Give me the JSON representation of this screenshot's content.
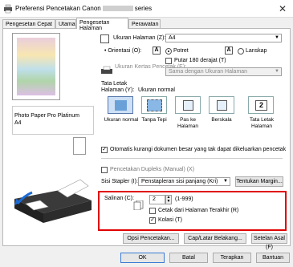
{
  "window": {
    "title_prefix": "Preferensi Pencetakan Canon",
    "title_suffix": "series",
    "close_glyph": "✕"
  },
  "tabs": [
    {
      "label": "Pengesetan Cepat"
    },
    {
      "label": "Utama"
    },
    {
      "label": "Pengesetan Halaman"
    },
    {
      "label": "Perawatan"
    }
  ],
  "preview": {
    "media_line1": "Photo Paper Pro Platinum",
    "media_line2": "A4"
  },
  "page_size": {
    "label": "Ukuran Halaman (Z):",
    "value": "A4"
  },
  "orientation": {
    "label": "Orientasi (O):",
    "portrait": "Potret",
    "landscape": "Lanskap",
    "rotate180": "Putar 180 derajat (T)",
    "portrait_icon": "A",
    "landscape_icon": "A"
  },
  "printer_paper_size": {
    "label": "Ukuran Kertas Pencetak (E):",
    "value": "Sama dengan Ukuran Halaman"
  },
  "page_layout": {
    "label_line1": "Tata Letak",
    "label_line2": "Halaman (Y):",
    "current": "Ukuran normal",
    "options": [
      "Ukuran normal",
      "Tanpa Tepi",
      "Pas ke Halaman",
      "Berskala",
      "Tata Letak Halaman"
    ],
    "icon_2": "2"
  },
  "auto_reduce": "Otomatis kurangi dokumen besar yang tak dapat dikeluarkan pencetak",
  "duplex": {
    "label": "Pencetakan Dupleks (Manual) (X)"
  },
  "stapling": {
    "label": "Sisi Stapler (I):",
    "value": "Penstapleran sisi panjang (Kri)",
    "margin_button": "Tentukan Margin..."
  },
  "copies": {
    "label": "Salinan (C):",
    "value": "2",
    "range": "(1-999)",
    "last_page": "Cetak dari Halaman Terakhir (R)",
    "collate": "Kolasi (T)"
  },
  "buttons": {
    "print_options": "Opsi Pencetakan...",
    "stamp": "Cap/Latar Belakang...",
    "defaults": "Setelan Asal (F)",
    "ok": "OK",
    "cancel": "Batal",
    "apply": "Terapkan",
    "help": "Bantuan"
  }
}
